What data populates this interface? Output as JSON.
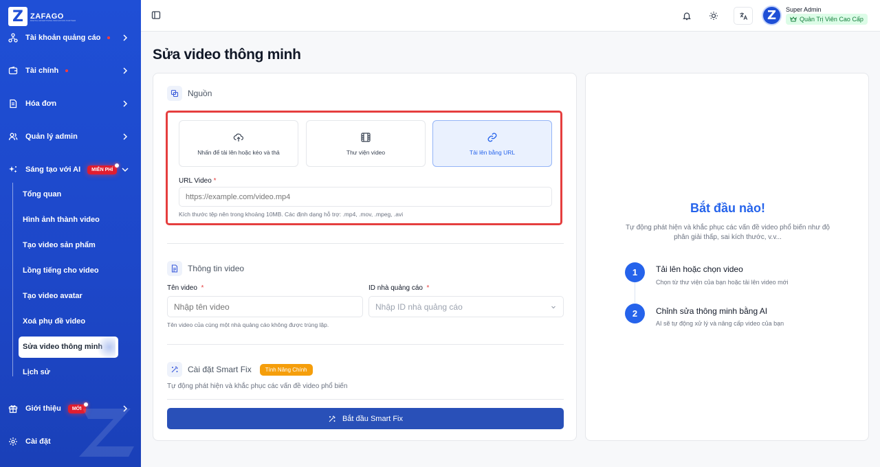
{
  "brand": {
    "name": "ZAFAGO",
    "tagline": "DIGITAL ADVERTISING INNOVATION PARTNER"
  },
  "sidebar": {
    "items": [
      {
        "label": "Tài khoản quảng cáo",
        "icon": "network-icon"
      },
      {
        "label": "Tài chính",
        "icon": "wallet-icon"
      },
      {
        "label": "Hóa đơn",
        "icon": "invoice-icon"
      },
      {
        "label": "Quản lý admin",
        "icon": "users-icon"
      },
      {
        "label": "Sáng tạo với AI",
        "icon": "sparkles-icon",
        "badge": "MIỄN PHÍ"
      },
      {
        "label": "Giới thiệu",
        "icon": "gift-icon",
        "badge": "MỚI"
      },
      {
        "label": "Cài đặt",
        "icon": "gear-icon"
      }
    ],
    "sub_items": [
      "Tổng quan",
      "Hình ảnh thành video",
      "Tạo video sản phẩm",
      "Lồng tiếng cho video",
      "Tạo video avatar",
      "Xoá phụ đề video",
      "Sửa video thông minh",
      "Lịch sử"
    ],
    "active_sub": "Sửa video thông minh"
  },
  "topbar": {
    "user_name": "Super Admin",
    "role": "Quản Trị Viên Cao Cấp",
    "avatar_letter": "Z"
  },
  "page": {
    "title": "Sửa video thông minh"
  },
  "source": {
    "heading": "Nguồn",
    "options": [
      {
        "label": "Nhấn để tải lên hoặc kéo và thả",
        "icon": "cloud-upload-icon",
        "selected": false
      },
      {
        "label": "Thư viện video",
        "icon": "film-icon",
        "selected": false
      },
      {
        "label": "Tải lên bằng URL",
        "icon": "link-icon",
        "selected": true
      }
    ],
    "url_label": "URL Video",
    "url_placeholder": "https://example.com/video.mp4",
    "url_hint": "Kích thước tệp nên trong khoảng 10MB. Các định dạng hỗ trợ: .mp4, .mov, .mpeg, .avi"
  },
  "video_info": {
    "heading": "Thông tin video",
    "name_label": "Tên video",
    "name_placeholder": "Nhập tên video",
    "advertiser_label": "ID nhà quảng cáo",
    "advertiser_placeholder": "Nhập ID nhà quảng cáo",
    "hint": "Tên video của cùng một nhà quảng cáo không được trùng lặp."
  },
  "smart_fix": {
    "heading": "Cài đặt Smart Fix",
    "badge": "Tính Năng Chính",
    "description": "Tự động phát hiện và khắc phục các vấn đề video phổ biến",
    "button": "Bắt đầu Smart Fix"
  },
  "intro": {
    "title": "Bắt đầu nào!",
    "description": "Tự động phát hiện và khắc phục các vấn đề video phổ biến như độ phân giải thấp, sai kích thước, v.v...",
    "steps": [
      {
        "number": "1",
        "title": "Tải lên hoặc chọn video",
        "subtitle": "Chọn từ thư viện của bạn hoặc tải lên video mới"
      },
      {
        "number": "2",
        "title": "Chỉnh sửa thông minh bằng AI",
        "subtitle": "AI sẽ tự động xử lý và nâng cấp video của bạn"
      }
    ]
  },
  "colors": {
    "primary": "#1f4fd6",
    "highlight": "#e53e3e",
    "accent_orange": "#f59e0b",
    "success": "#15803d"
  }
}
